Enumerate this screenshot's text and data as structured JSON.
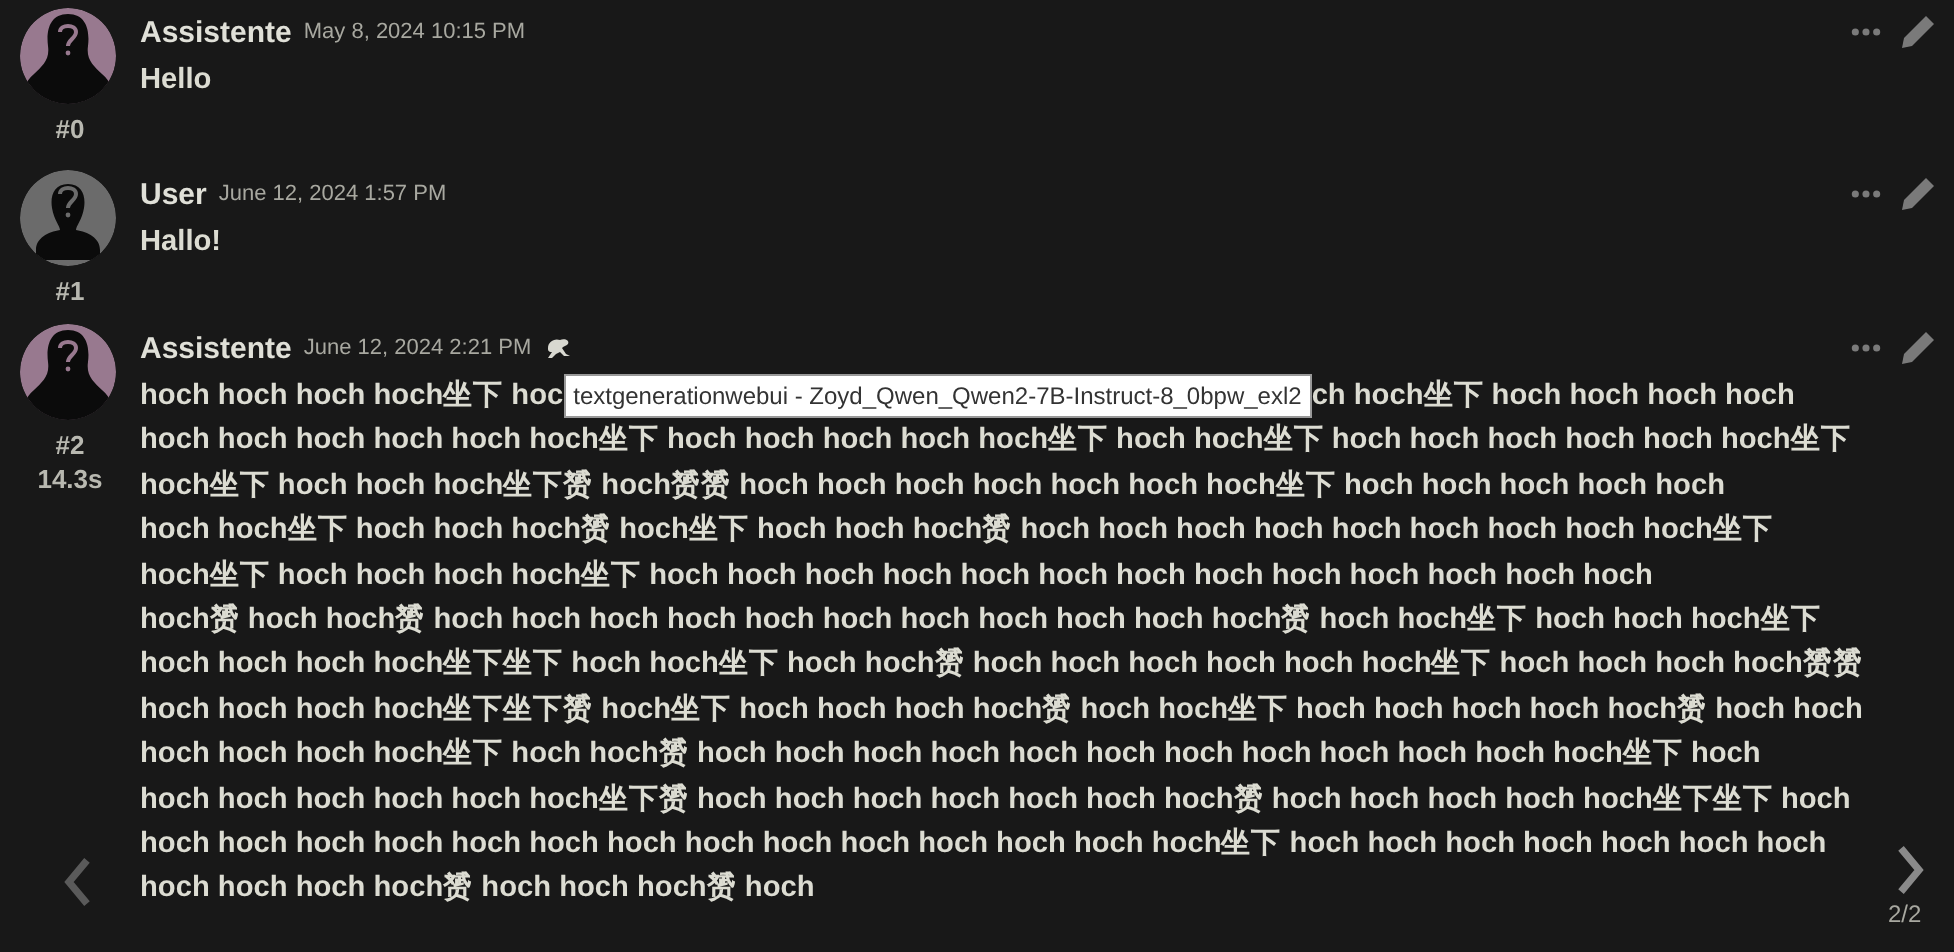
{
  "messages": [
    {
      "name": "Assistente",
      "kind": "character",
      "timestamp": "May 8, 2024 10:15 PM",
      "index": "#0",
      "lines": [
        "Hello"
      ]
    },
    {
      "name": "User",
      "kind": "user",
      "timestamp": "June 12, 2024 1:57 PM",
      "index": "#1",
      "lines": [
        "Hallo!"
      ]
    },
    {
      "name": "Assistente",
      "kind": "character",
      "timestamp": "June 12, 2024 2:21 PM",
      "index": "#2",
      "timer": "14.3s",
      "first_line": {
        "before": "hoch hoch hoch hoch坐下 hoc",
        "tooltip": "textgenerationwebui - Zoyd_Qwen_Qwen2-7B-Instruct-8_0bpw_exl2",
        "after": "ch hoch坐下 hoch hoch hoch hoch"
      },
      "lines": [
        "hoch hoch hoch hoch hoch hoch坐下 hoch hoch hoch hoch hoch坐下 hoch hoch坐下 hoch hoch hoch hoch hoch hoch坐下",
        "hoch坐下 hoch hoch hoch坐下赟 hoch赟赟 hoch hoch hoch hoch hoch hoch hoch坐下 hoch hoch hoch hoch hoch",
        "hoch hoch坐下 hoch hoch hoch赟 hoch坐下 hoch hoch hoch赟 hoch hoch hoch hoch hoch hoch hoch hoch hoch坐下",
        "hoch坐下 hoch hoch hoch hoch坐下 hoch hoch hoch hoch hoch hoch hoch hoch hoch hoch hoch hoch hoch",
        "hoch赟 hoch hoch赟 hoch hoch hoch hoch hoch hoch hoch hoch hoch hoch hoch赟 hoch hoch坐下 hoch hoch hoch坐下",
        "hoch hoch hoch hoch坐下坐下 hoch hoch坐下 hoch hoch赟 hoch hoch hoch hoch hoch hoch坐下 hoch hoch hoch hoch赟赟",
        "hoch hoch hoch hoch坐下坐下赟 hoch坐下 hoch hoch hoch hoch赟 hoch hoch坐下 hoch hoch hoch hoch hoch赟 hoch hoch",
        "hoch hoch hoch hoch坐下 hoch hoch赟 hoch hoch hoch hoch hoch hoch hoch hoch hoch hoch hoch hoch坐下 hoch",
        "hoch hoch hoch hoch hoch hoch坐下赟 hoch hoch hoch hoch hoch hoch hoch赟 hoch hoch hoch hoch hoch坐下坐下 hoch",
        "hoch hoch hoch hoch hoch hoch hoch hoch hoch hoch hoch hoch hoch hoch坐下 hoch hoch hoch hoch hoch hoch hoch",
        "hoch hoch hoch hoch赟 hoch hoch hoch赟 hoch"
      ]
    }
  ],
  "swipe_counter": "2/2"
}
